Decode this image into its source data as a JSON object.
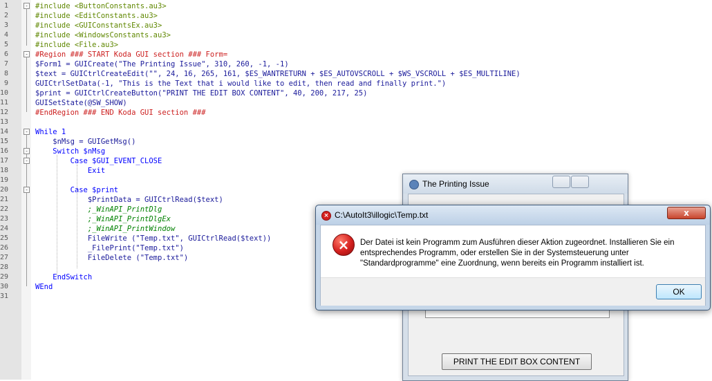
{
  "editor": {
    "line_numbers": [
      "1",
      "2",
      "3",
      "4",
      "5",
      "6",
      "7",
      "8",
      "9",
      "10",
      "11",
      "12",
      "13",
      "14",
      "15",
      "16",
      "17",
      "18",
      "19",
      "20",
      "21",
      "22",
      "23",
      "24",
      "25",
      "26",
      "27",
      "28",
      "29",
      "30",
      "31"
    ],
    "lines": [
      "#include <ButtonConstants.au3>",
      "#include <EditConstants.au3>",
      "#include <GUIConstantsEx.au3>",
      "#include <WindowsConstants.au3>",
      "#include <File.au3>",
      "#Region ### START Koda GUI section ### Form=",
      "$Form1 = GUICreate(\"The Printing Issue\", 310, 260, -1, -1)",
      "$text = GUICtrlCreateEdit(\"\", 24, 16, 265, 161, $ES_WANTRETURN + $ES_AUTOVSCROLL + $WS_VSCROLL + $ES_MULTILINE)",
      "GUICtrlSetData(-1, \"This is the Text that i would like to edit, then read and finally print.\")",
      "$print = GUICtrlCreateButton(\"PRINT THE EDIT BOX CONTENT\", 40, 200, 217, 25)",
      "GUISetState(@SW_SHOW)",
      "#EndRegion ### END Koda GUI section ###",
      "",
      "While 1",
      "    $nMsg = GUIGetMsg()",
      "    Switch $nMsg",
      "        Case $GUI_EVENT_CLOSE",
      "            Exit",
      "",
      "        Case $print",
      "            $PrintData = GUICtrlRead($text)",
      "            ;_WinAPI_PrintDlg",
      "            ;_WinAPI_PrintDlgEx",
      "            ;_WinAPI_PrintWindow",
      "            FileWrite (\"Temp.txt\", GUICtrlRead($text))",
      "            _FilePrint(\"Temp.txt\")",
      "            FileDelete (\"Temp.txt\")",
      "",
      "    EndSwitch",
      "WEnd",
      ""
    ]
  },
  "back_window": {
    "title": "The Printing Issue",
    "print_button_label": "PRINT THE EDIT BOX CONTENT"
  },
  "error_dialog": {
    "title": "C:\\AutoIt3\\illogic\\Temp.txt",
    "message": "Der Datei ist kein Programm zum Ausführen dieser Aktion zugeordnet. Installieren Sie ein\nentsprechendes Programm, oder erstellen Sie in der Systemsteuerung unter\n\"Standardprogramme\" eine Zuordnung, wenn bereits ein Programm installiert ist.",
    "ok_label": "OK",
    "close_label": "x"
  },
  "colors": {
    "directive": "#5f8700",
    "region": "#cc1f1f",
    "keyword": "#0000ff",
    "string": "#9b0000",
    "comment": "#008000",
    "error_red": "#d4201e"
  }
}
